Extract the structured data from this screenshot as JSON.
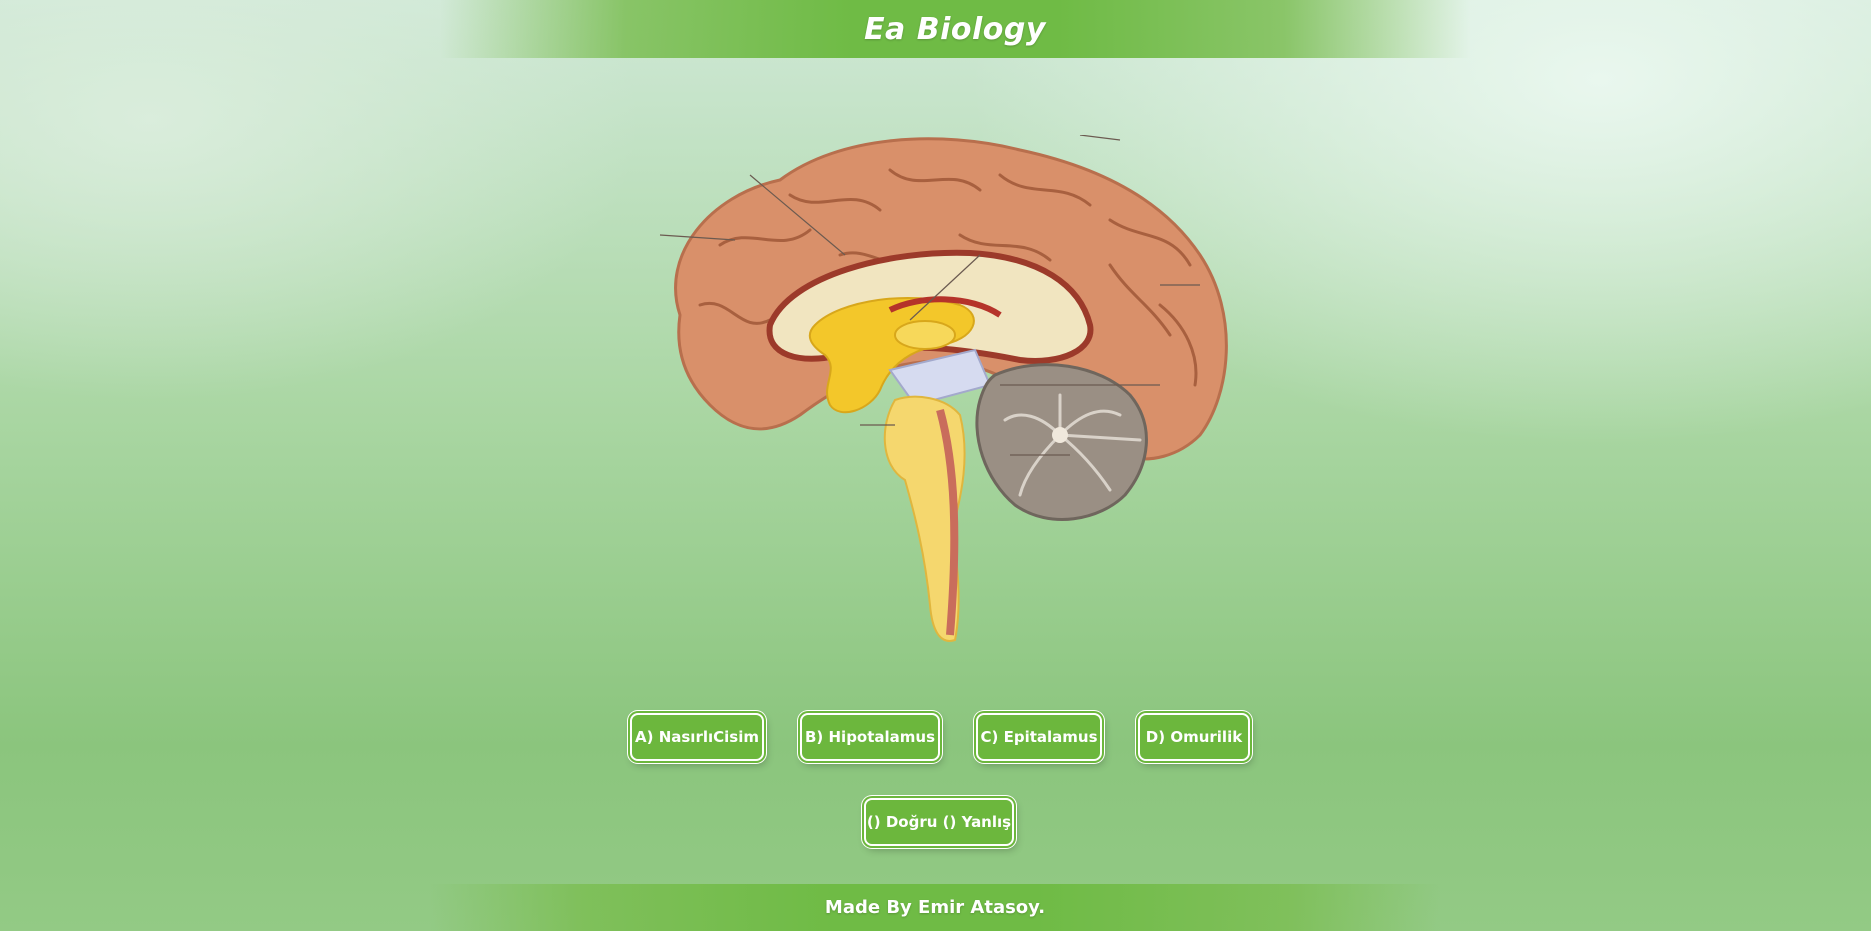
{
  "header": {
    "title": "Ea Biology"
  },
  "diagram": {
    "icon": "brain-sagittal-section"
  },
  "answers": {
    "a": "A) NasırlıCisim",
    "b": "B) Hipotalamus",
    "c": "C) Epitalamus",
    "d": "D) Omurilik"
  },
  "true_false": {
    "label": "() Doğru () Yanlış"
  },
  "footer": {
    "credit": "Made By Emir Atasoy."
  },
  "colors": {
    "accent": "#6cb73d",
    "cortex": "#d9906a",
    "cerebellum": "#9a8f84",
    "brainstem": "#f5d76e"
  }
}
